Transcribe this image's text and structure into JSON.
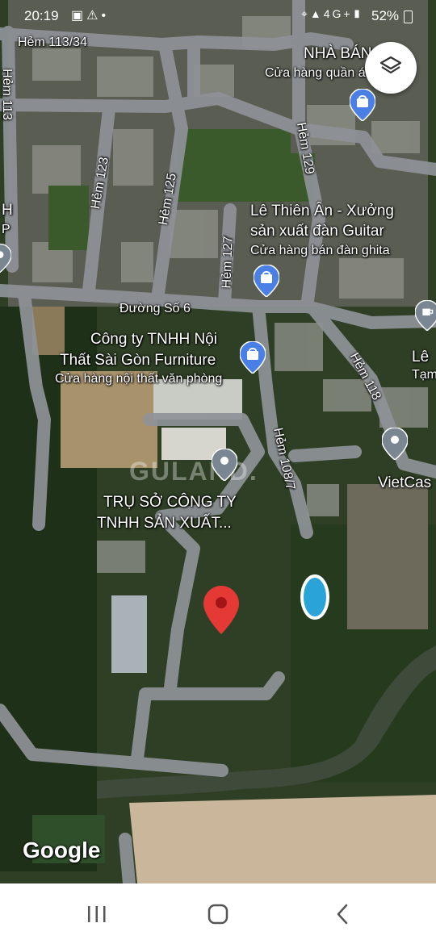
{
  "status_bar": {
    "time": "20:19",
    "battery": "52%",
    "network": "4G+",
    "left_icons": [
      "image-icon",
      "alert-icon",
      "dot-icon"
    ],
    "right_icons": [
      "location-icon",
      "wifi-icon",
      "signal-icon"
    ]
  },
  "map": {
    "roads": {
      "hem_113_34": "Hẻm 113/34",
      "hem_113": "Hẻm 113",
      "hem_123": "Hẻm 123",
      "hem_125": "Hẻm 125",
      "hem_127": "Hẻm 127",
      "hem_129": "Hẻm 129",
      "hem_118": "Hẻm 118",
      "hem_108_7": "Hẻm 108/7",
      "duong_so_6": "Đường Số 6"
    },
    "places": {
      "nha_ban": {
        "title": "NHÀ BÁN",
        "subtitle": "Cửa hàng quần á"
      },
      "le_thien_an": {
        "title_line1": "Lê Thiên Ân - Xưởng",
        "title_line2": "sản xuất đàn Guitar",
        "subtitle": "Cửa hàng bán đàn ghita"
      },
      "cong_ty_noi_that": {
        "title_line1": "Công ty TNHH Nội",
        "title_line2": "Thất Sài Gòn Furniture",
        "subtitle": "Cửa hàng nội thất văn phòng"
      },
      "tru_so": {
        "title_line1": "TRỤ SỞ CÔNG TY",
        "title_line2": "TNHH SẢN XUẤT..."
      },
      "vietcas": {
        "title": "VietCas"
      },
      "le_partial": {
        "title": "Lê",
        "subtitle": "Tạm"
      },
      "h_partial": {
        "title": "H",
        "subtitle": "P"
      }
    },
    "watermark": "GULAND.",
    "logo": "Google",
    "colors": {
      "pin_red": "#e53935",
      "shop_pin_blue": "#4a7fe6",
      "generic_pin_gray": "#7a8793"
    }
  },
  "nav_bar": {
    "buttons": [
      "recent-apps-icon",
      "home-icon",
      "back-icon"
    ]
  }
}
